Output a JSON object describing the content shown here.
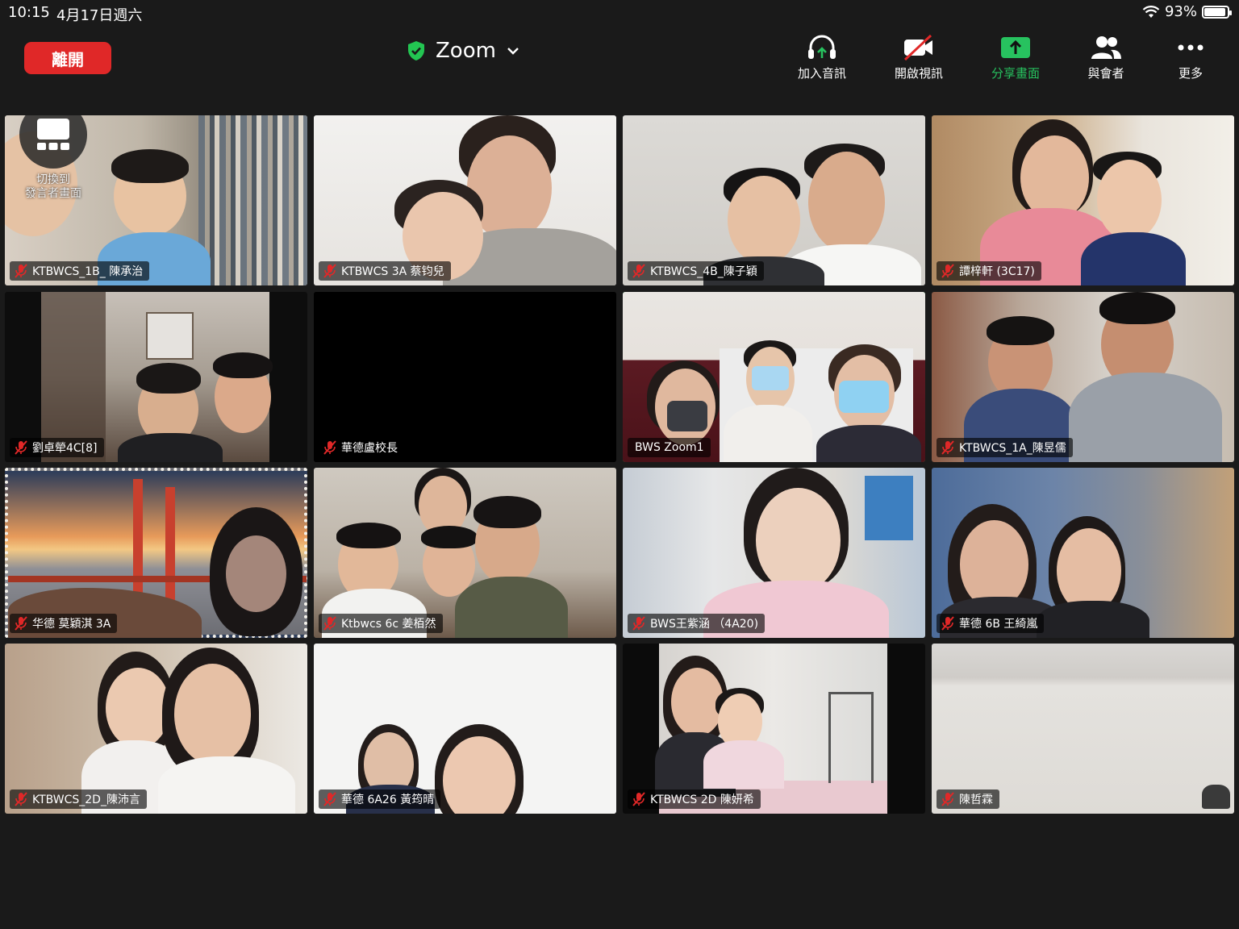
{
  "status_bar": {
    "time": "10:15",
    "date": "4月17日週六",
    "battery_percent": "93%",
    "battery_level": 0.93,
    "wifi_icon": "wifi-icon"
  },
  "toolbar": {
    "leave_label": "離開",
    "meeting_name": "Zoom",
    "security_icon": "shield-check-icon",
    "items": [
      {
        "label": "加入音訊",
        "icon": "headphones-icon"
      },
      {
        "label": "開啟視訊",
        "icon": "video-off-icon"
      },
      {
        "label": "分享畫面",
        "icon": "share-screen-icon"
      },
      {
        "label": "與會者",
        "icon": "participants-icon"
      },
      {
        "label": "更多",
        "icon": "more-icon"
      }
    ],
    "share_color": "#27c25f",
    "leave_color": "#e02828"
  },
  "switch_view": {
    "label_line1": "切換到",
    "label_line2": "發言者畫面"
  },
  "participants": [
    {
      "name": "KTBWCS_1B_ 陳承治",
      "muted": true
    },
    {
      "name": "KTBWCS 3A 蔡钧兒",
      "muted": true
    },
    {
      "name": "KTBWCS_4B_陳子穎",
      "muted": true
    },
    {
      "name": "譚梓軒 (3C17)",
      "muted": true
    },
    {
      "name": "劉卓犖4C[8]",
      "muted": true
    },
    {
      "name": "華德盧校長",
      "muted": true
    },
    {
      "name": "BWS Zoom1",
      "muted": false,
      "active_speaker": true
    },
    {
      "name": "KTBWCS_1A_陳昱儒",
      "muted": true
    },
    {
      "name": "华德 莫穎淇 3A",
      "muted": true
    },
    {
      "name": "Ktbwcs 6c 姜栢然",
      "muted": true
    },
    {
      "name": "BWS王紫涵 （4A20)",
      "muted": true
    },
    {
      "name": "華德 6B 王綺嵐",
      "muted": true
    },
    {
      "name": "KTBWCS_2D_陳沛言",
      "muted": true
    },
    {
      "name": "華德 6A26 黃筠晴",
      "muted": true
    },
    {
      "name": "KTBWCS 2D 陳妍希",
      "muted": true
    },
    {
      "name": "陳哲霖",
      "muted": true
    }
  ],
  "active_speaker_color": "#23c552"
}
